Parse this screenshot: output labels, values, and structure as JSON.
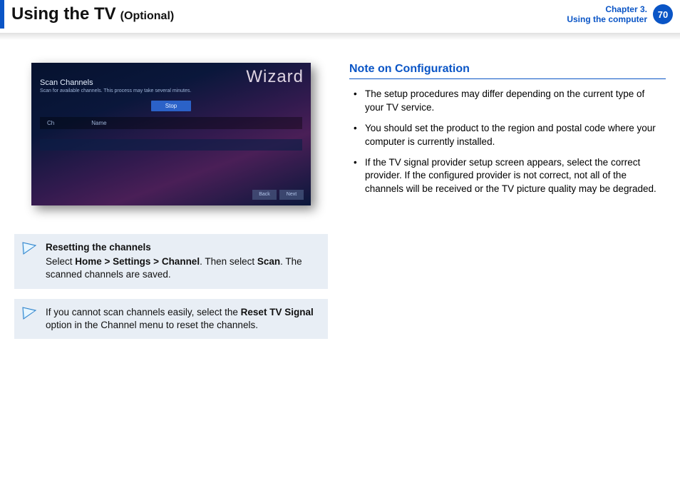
{
  "header": {
    "title": "Using the TV",
    "subtitle": "(Optional)",
    "chapter_line1": "Chapter 3.",
    "chapter_line2": "Using the computer",
    "page_number": "70"
  },
  "wizard": {
    "big_label": "Wizard",
    "scan_title": "Scan Channels",
    "scan_sub": "Scan for available channels. This process may take several minutes.",
    "stop_label": "Stop",
    "col_ch": "Ch",
    "col_name": "Name",
    "back_label": "Back",
    "next_label": "Next"
  },
  "note1": {
    "title": "Resetting the channels",
    "pre": "Select ",
    "path": "Home > Settings > Channel",
    "mid": ". Then select ",
    "scan": "Scan",
    "post": ". The scanned channels are saved."
  },
  "note2": {
    "pre": "If you cannot scan channels easily, select the ",
    "option": "Reset TV Signal",
    "post": " option in the Channel menu to reset the channels."
  },
  "config": {
    "heading": "Note on Configuration",
    "bullets": [
      "The setup procedures may differ depending on the current type of your TV service.",
      "You should set the product to the region and postal code where your computer is currently installed.",
      "If the TV signal provider setup screen appears, select the correct provider. If the configured provider is not correct, not all of the channels will be received or the TV picture quality may be degraded."
    ]
  }
}
